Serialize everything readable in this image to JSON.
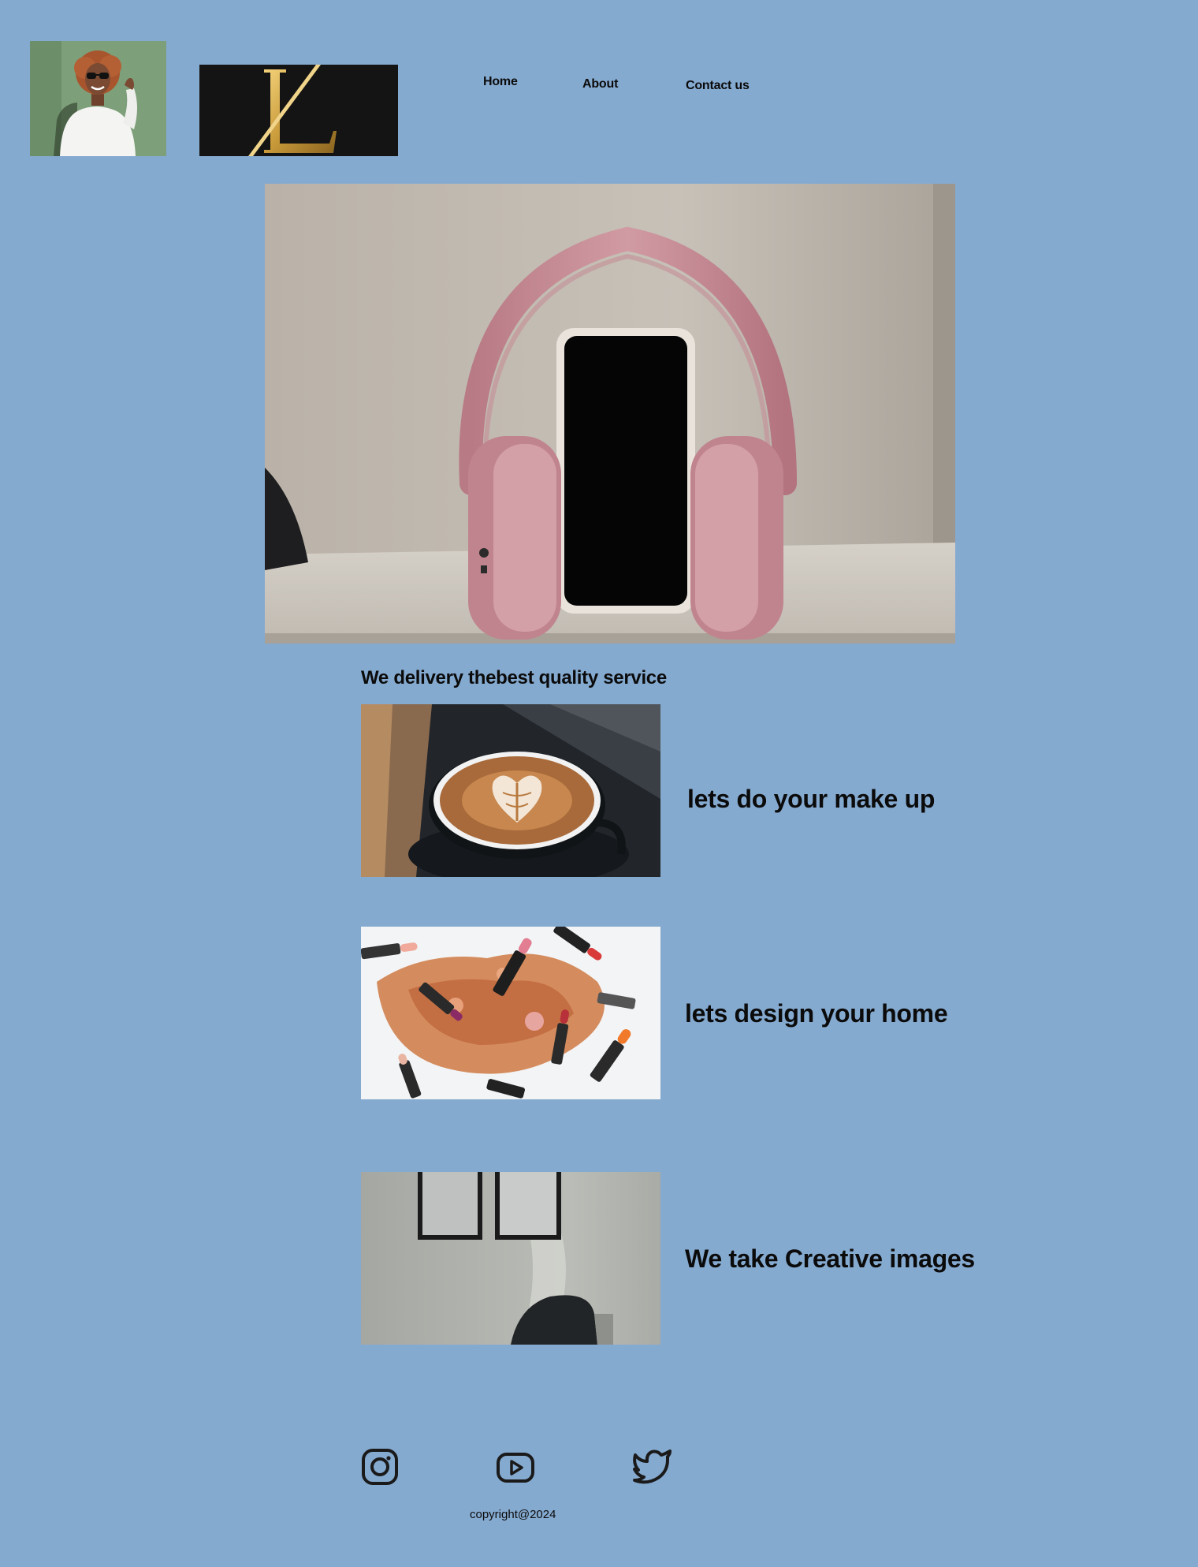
{
  "header": {
    "nav": [
      {
        "label": "Home"
      },
      {
        "label": "About"
      },
      {
        "label": "Contact us"
      }
    ]
  },
  "main": {
    "heading": "We delivery thebest quality service",
    "services": [
      {
        "text": "lets do your  make up"
      },
      {
        "text": "lets design your home"
      },
      {
        "text": "We take Creative images"
      }
    ]
  },
  "footer": {
    "social": [
      {
        "icon": "instagram-icon"
      },
      {
        "icon": "youtube-icon"
      },
      {
        "icon": "twitter-icon"
      }
    ],
    "copyright": "copyright@2024"
  },
  "colors": {
    "background": "#85aad0",
    "text": "#0b0b0b"
  }
}
